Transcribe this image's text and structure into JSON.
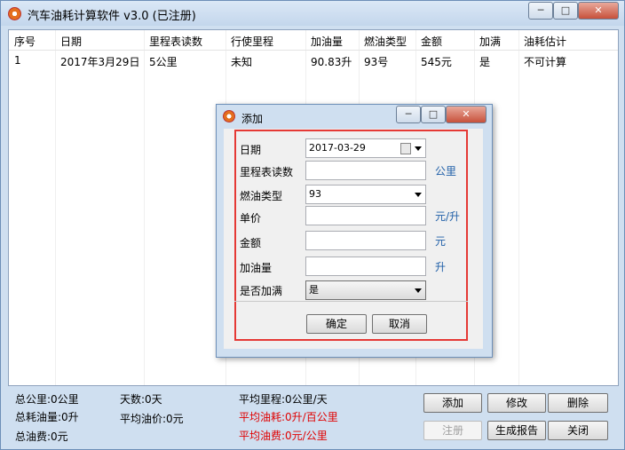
{
  "app": {
    "title": "汽车油耗计算软件 v3.0 (已注册)"
  },
  "window_controls": {
    "minimize": "─",
    "maximize": "□",
    "close": "✕"
  },
  "table": {
    "headers": [
      "序号",
      "日期",
      "里程表读数",
      "行使里程",
      "加油量",
      "燃油类型",
      "金额",
      "加满",
      "油耗估计"
    ],
    "rows": [
      [
        "1",
        "2017年3月29日",
        "5公里",
        "未知",
        "90.83升",
        "93号",
        "545元",
        "是",
        "不可计算"
      ]
    ]
  },
  "summary": {
    "total_km": "总公里:0公里",
    "total_fuel": "总耗油量:0升",
    "total_cost": "总油费:0元",
    "days": "天数:0天",
    "avg_price": "平均油价:0元",
    "avg_mileage": "平均里程:0公里/天",
    "avg_consumption": "平均油耗:0升/百公里",
    "avg_fuel_cost": "平均油费:0元/公里"
  },
  "buttons": {
    "add": "添加",
    "edit": "修改",
    "delete": "删除",
    "register": "注册",
    "report": "生成报告",
    "close": "关闭"
  },
  "dialog": {
    "title": "添加",
    "labels": {
      "date": "日期",
      "odometer": "里程表读数",
      "fuel_type": "燃油类型",
      "unit_price": "单价",
      "amount": "金额",
      "fuel_volume": "加油量",
      "full": "是否加满"
    },
    "values": {
      "date": "2017-03-29",
      "odometer": "",
      "fuel_type": "93",
      "unit_price": "",
      "amount": "",
      "fuel_volume": "",
      "full": "是"
    },
    "units": {
      "odometer": "公里",
      "unit_price": "元/升",
      "amount": "元",
      "fuel_volume": "升"
    },
    "ok": "确定",
    "cancel": "取消"
  }
}
